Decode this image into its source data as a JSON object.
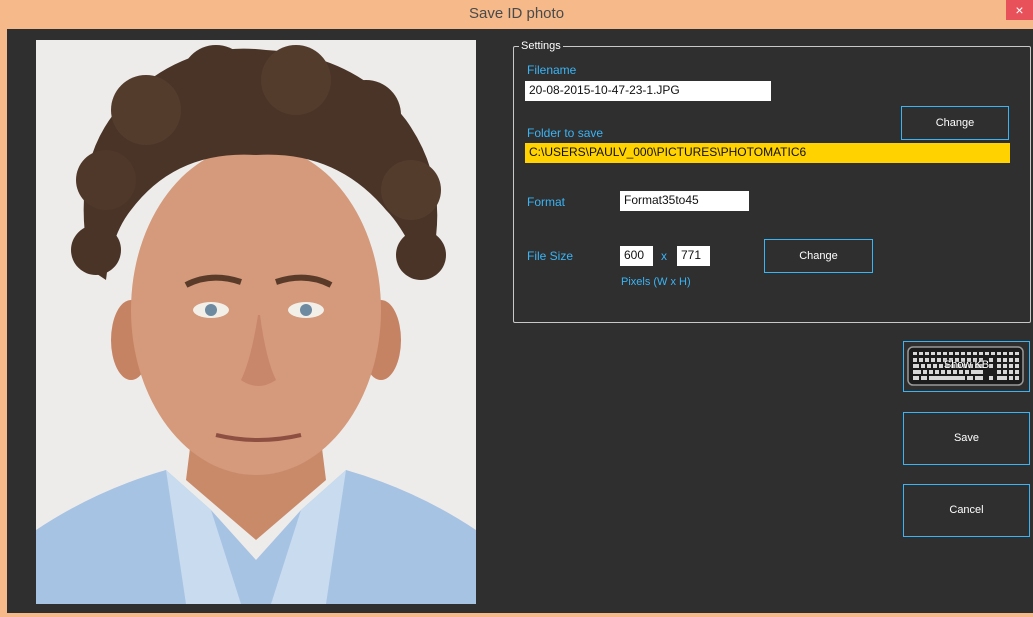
{
  "window": {
    "title": "Save ID photo",
    "close": "×"
  },
  "settings": {
    "legend": "Settings",
    "filename_label": "Filename",
    "filename_value": "20-08-2015-10-47-23-1.JPG",
    "folder_label": "Folder to save",
    "folder_value": "C:\\USERS\\PAULV_000\\PICTURES\\PHOTOMATIC6",
    "change_folder_label": "Change",
    "format_label": "Format",
    "format_value": "Format35to45",
    "filesize_label": "File Size",
    "width_value": "600",
    "x_label": "x",
    "height_value": "771",
    "pixels_label": "Pixels (W x H)",
    "change_size_label": "Change"
  },
  "actions": {
    "show_kb_label": "Show KB",
    "save_label": "Save",
    "cancel_label": "Cancel"
  },
  "colors": {
    "accent": "#3ab4f5",
    "title_bar": "#f5b98a",
    "folder_highlight": "#ffd200",
    "background": "#2f2f2f"
  }
}
